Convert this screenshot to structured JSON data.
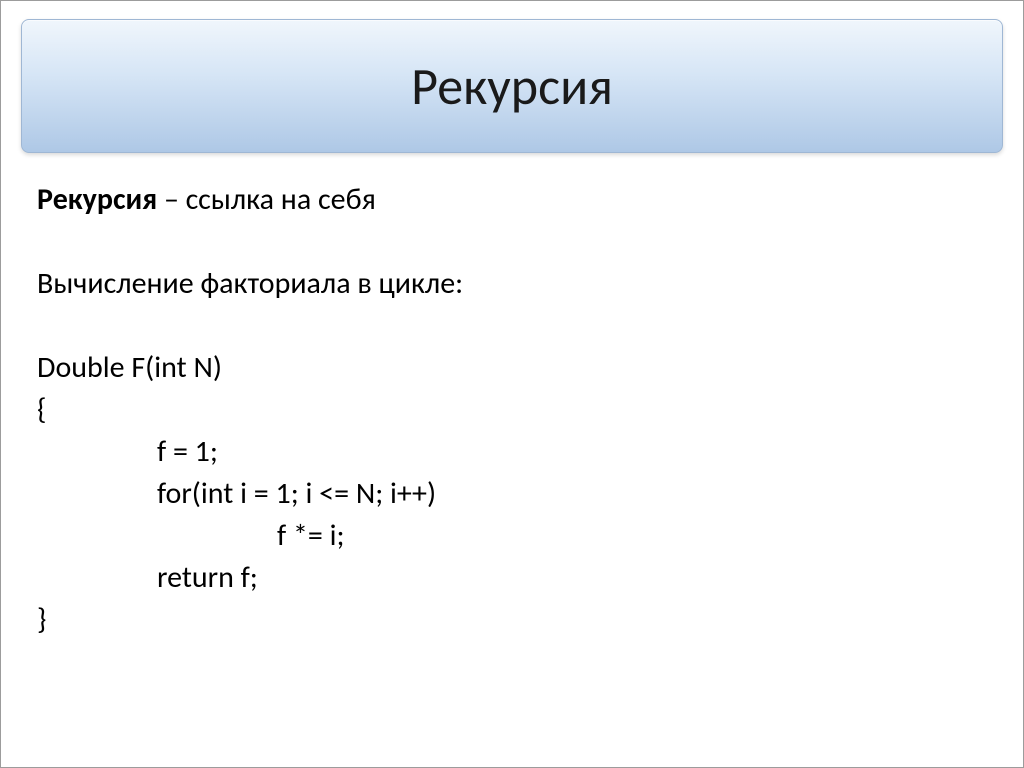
{
  "slide": {
    "title": "Рекурсия",
    "def_term": "Рекурсия",
    "def_tail": " – ссылка на себя",
    "subheader": "Вычисление факториала в цикле:",
    "code": {
      "sig": "Double F(int N)",
      "open": "{",
      "l1": "f = 1;",
      "l2": "for(int i = 1; i <= N; i++)",
      "l3": "f *= i;",
      "l4": "return f;",
      "close": "}"
    }
  }
}
